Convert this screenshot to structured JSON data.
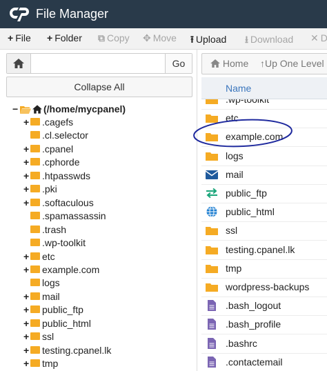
{
  "app": {
    "title": "File Manager"
  },
  "toolbar": [
    {
      "label": "File",
      "icon": "plus-icon",
      "enabled": true
    },
    {
      "label": "Folder",
      "icon": "plus-icon",
      "enabled": true
    },
    {
      "label": "Copy",
      "icon": "copy-icon",
      "enabled": false
    },
    {
      "label": "Move",
      "icon": "move-icon",
      "enabled": false
    },
    {
      "label": "Upload",
      "icon": "upload-icon",
      "enabled": true
    },
    {
      "label": "Download",
      "icon": "download-icon",
      "enabled": false
    },
    {
      "label": "D",
      "icon": "delete-icon",
      "enabled": false
    }
  ],
  "path_bar": {
    "value": "",
    "go_label": "Go"
  },
  "collapse_label": "Collapse All",
  "tree": {
    "root": "(/home/mycpanel)",
    "items": [
      {
        "name": ".cagefs",
        "expandable": true
      },
      {
        "name": ".cl.selector",
        "expandable": false
      },
      {
        "name": ".cpanel",
        "expandable": true
      },
      {
        "name": ".cphorde",
        "expandable": true
      },
      {
        "name": ".htpasswds",
        "expandable": true
      },
      {
        "name": ".pki",
        "expandable": true
      },
      {
        "name": ".softaculous",
        "expandable": true
      },
      {
        "name": ".spamassassin",
        "expandable": false
      },
      {
        "name": ".trash",
        "expandable": false
      },
      {
        "name": ".wp-toolkit",
        "expandable": false
      },
      {
        "name": "etc",
        "expandable": true
      },
      {
        "name": "example.com",
        "expandable": true
      },
      {
        "name": "logs",
        "expandable": false
      },
      {
        "name": "mail",
        "expandable": true
      },
      {
        "name": "public_ftp",
        "expandable": true
      },
      {
        "name": "public_html",
        "expandable": true
      },
      {
        "name": "ssl",
        "expandable": true
      },
      {
        "name": "testing.cpanel.lk",
        "expandable": true
      },
      {
        "name": "tmp",
        "expandable": true
      }
    ]
  },
  "nav": {
    "home_label": "Home",
    "up_label": "Up One Level"
  },
  "list": {
    "column_name": "Name",
    "rows": [
      {
        "name": ".wp-toolkit",
        "type": "folder"
      },
      {
        "name": "etc",
        "type": "folder"
      },
      {
        "name": "example.com",
        "type": "folder"
      },
      {
        "name": "logs",
        "type": "folder"
      },
      {
        "name": "mail",
        "type": "mail"
      },
      {
        "name": "public_ftp",
        "type": "ftp"
      },
      {
        "name": "public_html",
        "type": "web"
      },
      {
        "name": "ssl",
        "type": "folder"
      },
      {
        "name": "testing.cpanel.lk",
        "type": "folder"
      },
      {
        "name": "tmp",
        "type": "folder"
      },
      {
        "name": "wordpress-backups",
        "type": "folder"
      },
      {
        "name": ".bash_logout",
        "type": "file"
      },
      {
        "name": ".bash_profile",
        "type": "file"
      },
      {
        "name": ".bashrc",
        "type": "file"
      },
      {
        "name": ".contactemail",
        "type": "file"
      }
    ]
  },
  "colors": {
    "header_bg": "#293a4a",
    "folder": "#f5ab24",
    "link": "#3b76bd",
    "annotation": "#1f2a9e",
    "file_icon": "#7b65b3",
    "mail_icon": "#1f5a9c",
    "ftp_icon": "#1aa57a",
    "web_icon": "#1f7fd1"
  }
}
